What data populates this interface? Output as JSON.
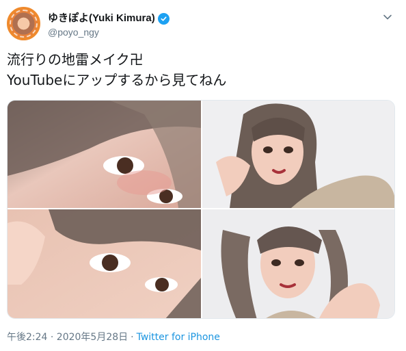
{
  "author": {
    "display_name": "ゆきぽよ(Yuki Kimura)",
    "handle": "@poyo_ngy",
    "verified": true
  },
  "tweet": {
    "lines": [
      "流行りの地雷メイク卍",
      "YouTubeにアップするから見てねん"
    ]
  },
  "media": {
    "photos": [
      {
        "name": "eye-closeup-1"
      },
      {
        "name": "pigtails-pose-1"
      },
      {
        "name": "eye-closeup-2"
      },
      {
        "name": "pigtails-pose-2"
      }
    ]
  },
  "meta": {
    "timestamp": "午後2:24 · 2020年5月28日",
    "separator": "·",
    "source": "Twitter for iPhone"
  },
  "colors": {
    "accent": "#1da1f2",
    "link": "#1b95e0",
    "secondary_text": "#657786",
    "avatar_ring": "#ef8a2d"
  },
  "icons": {
    "verified": "verified-badge-icon",
    "menu": "chevron-down-icon"
  }
}
